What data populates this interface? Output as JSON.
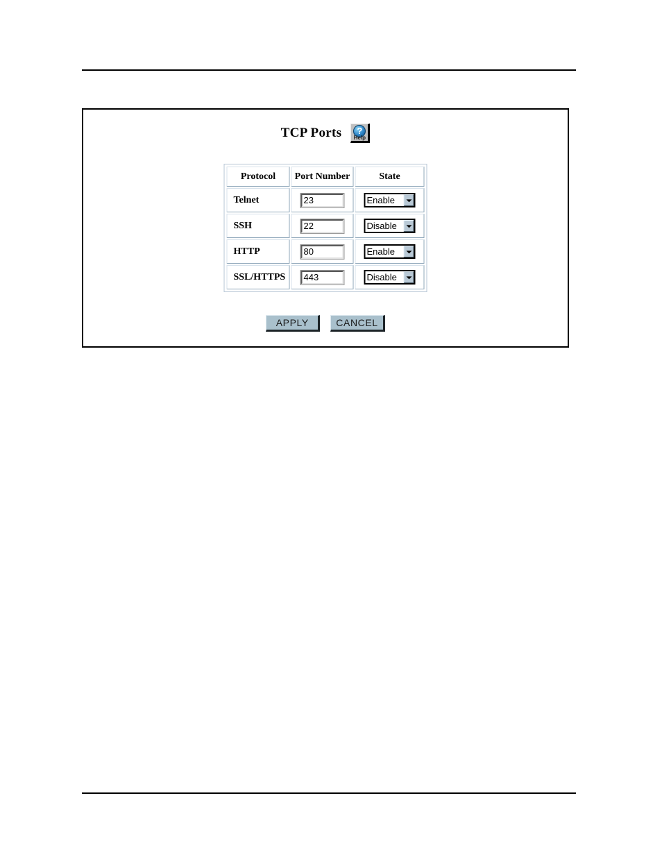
{
  "page": {
    "rule_top": true,
    "rule_bottom": true
  },
  "panel": {
    "title": "TCP Ports",
    "help": {
      "icon": "help-question-icon",
      "glyph": "?",
      "label": "Help"
    }
  },
  "table": {
    "headers": [
      "Protocol",
      "Port Number",
      "State"
    ],
    "rows": [
      {
        "protocol": "Telnet",
        "port": "23",
        "state": "Enable"
      },
      {
        "protocol": "SSH",
        "port": "22",
        "state": "Disable"
      },
      {
        "protocol": "HTTP",
        "port": "80",
        "state": "Enable"
      },
      {
        "protocol": "SSL/HTTPS",
        "port": "443",
        "state": "Disable"
      }
    ],
    "state_options": [
      "Enable",
      "Disable"
    ]
  },
  "buttons": {
    "apply": "APPLY",
    "cancel": "CANCEL"
  },
  "colors": {
    "button_face": "#a9c0cc",
    "cell_border_light": "#d7e2eb",
    "cell_border_dark": "#8fa7ba",
    "help_blue": "#2f86c8",
    "frame": "#000000"
  }
}
